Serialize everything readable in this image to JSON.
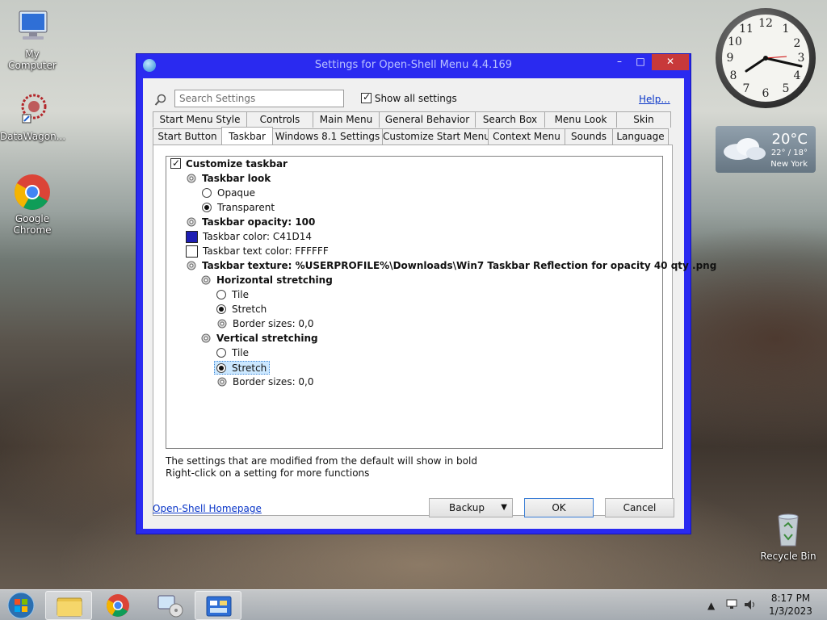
{
  "desktop": {
    "icons": [
      {
        "label": "My Computer"
      },
      {
        "label": "DataWagon..."
      },
      {
        "label": "Google Chrome"
      },
      {
        "label": "Recycle Bin"
      }
    ],
    "clock": {
      "numbers": [
        "12",
        "1",
        "2",
        "3",
        "4",
        "5",
        "6",
        "7",
        "8",
        "9",
        "10",
        "11"
      ]
    },
    "weather": {
      "temp": "20°C",
      "range": "22° / 18°",
      "city": "New York"
    }
  },
  "window": {
    "title": "Settings for Open-Shell Menu 4.4.169",
    "close_glyph": "✕",
    "min_glyph": "–",
    "max_glyph": "□",
    "search": {
      "placeholder": "Search Settings"
    },
    "show_all_label": "Show all settings",
    "help_label": "Help...",
    "tabs_row1": [
      "Start Menu Style",
      "Controls",
      "Main Menu",
      "General Behavior",
      "Search Box",
      "Menu Look",
      "Skin"
    ],
    "tabs_row2": [
      "Start Button",
      "Taskbar",
      "Windows 8.1 Settings",
      "Customize Start Menu",
      "Context Menu",
      "Sounds",
      "Language"
    ],
    "active_tab": "Taskbar",
    "tree": {
      "customize_taskbar": "Customize taskbar",
      "taskbar_look": "Taskbar look",
      "opaque": "Opaque",
      "transparent": "Transparent",
      "opacity": "Taskbar opacity: 100",
      "color": "Taskbar color: C41D14",
      "text_color": "Taskbar text color: FFFFFF",
      "texture": "Taskbar texture: %USERPROFILE%\\Downloads\\Win7 Taskbar Reflection for opacity 40 qty .png",
      "horizontal": "Horizontal stretching",
      "h_tile": "Tile",
      "h_stretch": "Stretch",
      "h_border": "Border sizes: 0,0",
      "vertical": "Vertical stretching",
      "v_tile": "Tile",
      "v_stretch": "Stretch",
      "v_border": "Border sizes: 0,0"
    },
    "colors": {
      "taskbar_swatch": "#1e1eb4",
      "text_swatch": "#ffffff"
    },
    "footnote1": "The settings that are modified from the default will show in bold",
    "footnote2": "Right-click on a setting for more functions",
    "homepage_label": "Open-Shell Homepage",
    "backup_label": "Backup",
    "ok_label": "OK",
    "cancel_label": "Cancel"
  },
  "taskbar": {
    "time": "8:17 PM",
    "date": "1/3/2023"
  }
}
